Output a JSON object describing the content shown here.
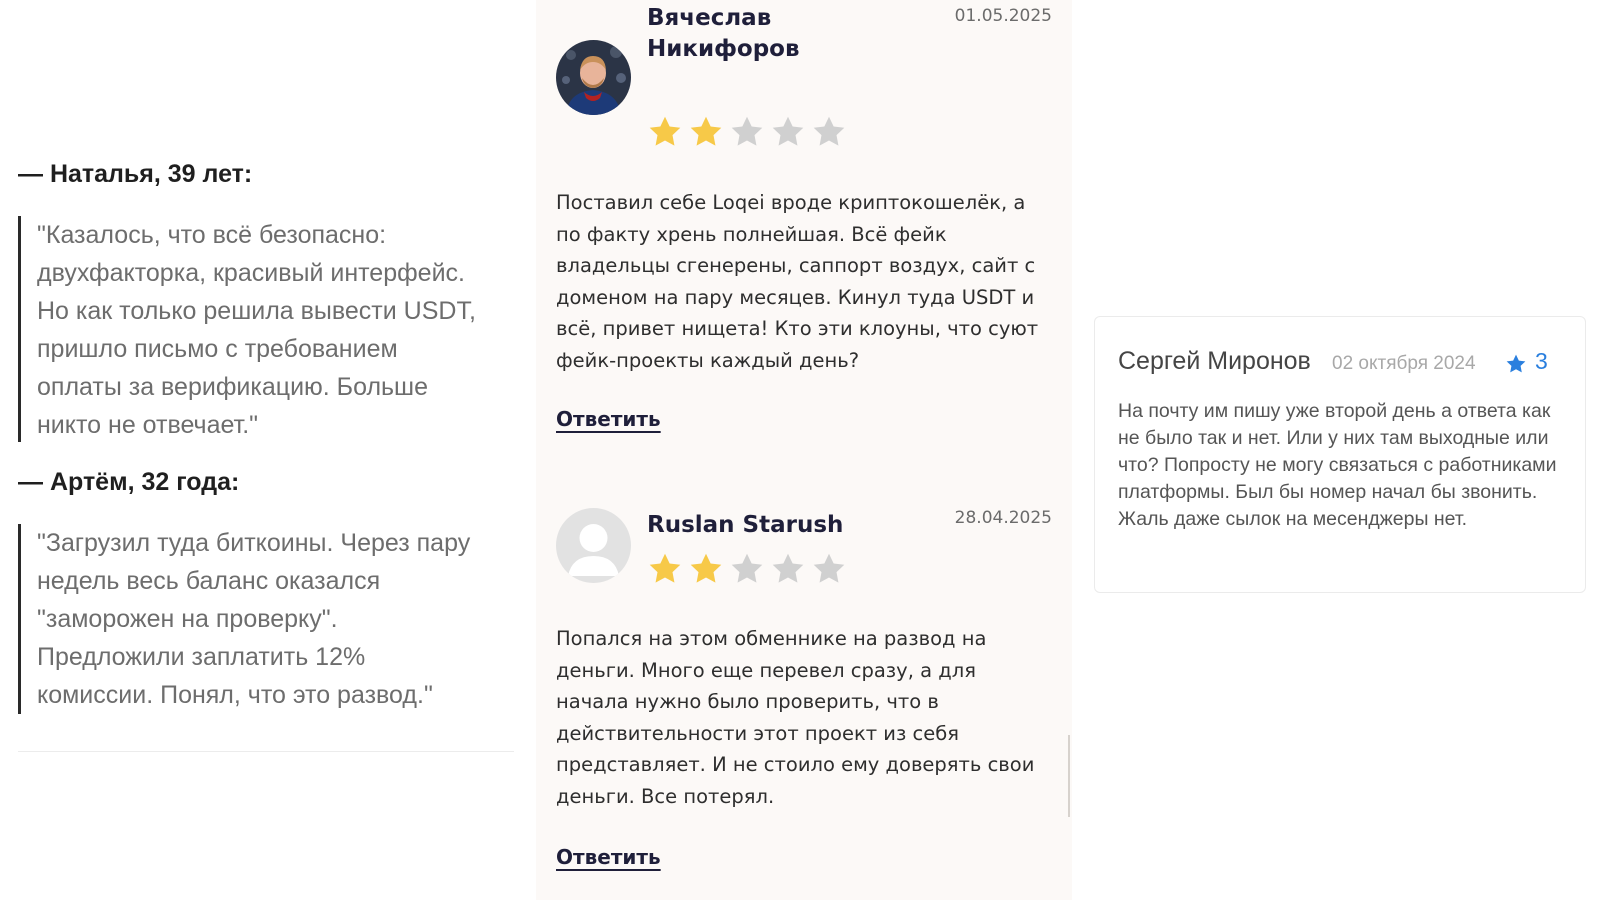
{
  "left_quotes": [
    {
      "author": "— Наталья, 39 лет:",
      "lines": [
        "\"Казалось, что всё безопасно:",
        "двухфакторка, красивый интерфейс.",
        "Но как только решила вывести USDT,",
        "пришло письмо с требованием",
        "оплаты за верификацию. Больше",
        "никто не отвечает.\""
      ]
    },
    {
      "author": "— Артём, 32 года:",
      "lines": [
        "\"Загрузил туда биткоины. Через пару",
        "недель весь баланс оказался",
        "\"заморожен на проверку\".",
        "Предложили заплатить 12%",
        "комиссии. Понял, что это развод.\""
      ]
    }
  ],
  "reviews": [
    {
      "name_line1": "Вячеслав",
      "name_line2": "Никифоров",
      "date": "01.05.2025",
      "rating": 2,
      "max_rating": 5,
      "text": "Поставил себе Loqei вроде криптокошелёк, а по факту хрень полнейшая. Всё фейк владельцы сгенерены, саппорт воздух, сайт с доменом на пару месяцев. Кинул туда USDT и всё, привет нищета! Кто эти клоуны, что суют фейк-проекты каждый день?",
      "reply_label": "Ответить",
      "avatar": "photo-avatar"
    },
    {
      "name_line1": "Ruslan Starush",
      "date": "28.04.2025",
      "rating": 2,
      "max_rating": 5,
      "text": "Попался на этом обменнике на развод на деньги. Много еще перевел сразу, а для начала нужно было проверить, что в действительности этот проект из себя представляет. И не стоило ему доверять свои деньги. Все потерял.",
      "reply_label": "Ответить",
      "avatar": "default-user-avatar"
    }
  ],
  "card": {
    "name": "Сергей Миронов",
    "date": "02 октября 2024",
    "rating": "3",
    "text": "На почту им пишу уже второй день а ответа как не было так и нет. Или у них там выходные или что? Попросту не могу связаться с работниками платформы. Был бы номер начал бы звонить. Жаль даже сылок на месенджеры нет."
  },
  "colors": {
    "star_filled": "#f7c948",
    "star_empty": "#d0d0d0",
    "card_star": "#2a7fde",
    "review_bg": "#fcf9f7"
  }
}
